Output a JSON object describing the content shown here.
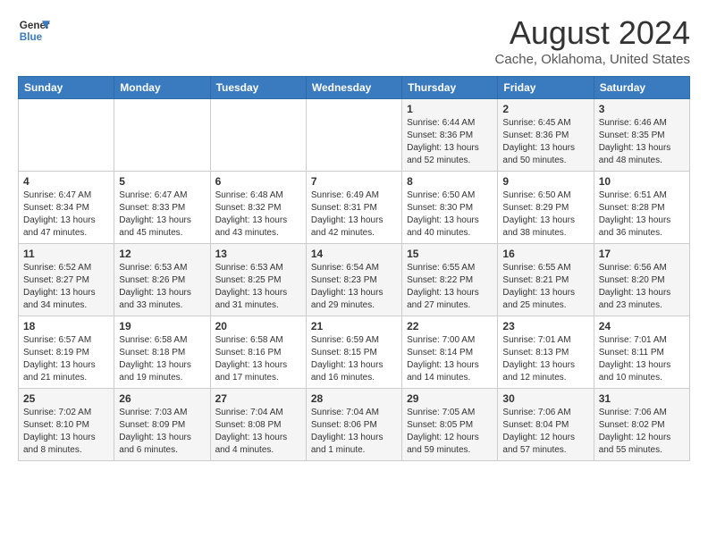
{
  "logo": {
    "line1": "General",
    "line2": "Blue"
  },
  "title": "August 2024",
  "subtitle": "Cache, Oklahoma, United States",
  "weekdays": [
    "Sunday",
    "Monday",
    "Tuesday",
    "Wednesday",
    "Thursday",
    "Friday",
    "Saturday"
  ],
  "weeks": [
    [
      {
        "day": "",
        "sunrise": "",
        "sunset": "",
        "daylight": ""
      },
      {
        "day": "",
        "sunrise": "",
        "sunset": "",
        "daylight": ""
      },
      {
        "day": "",
        "sunrise": "",
        "sunset": "",
        "daylight": ""
      },
      {
        "day": "",
        "sunrise": "",
        "sunset": "",
        "daylight": ""
      },
      {
        "day": "1",
        "sunrise": "Sunrise: 6:44 AM",
        "sunset": "Sunset: 8:36 PM",
        "daylight": "Daylight: 13 hours and 52 minutes."
      },
      {
        "day": "2",
        "sunrise": "Sunrise: 6:45 AM",
        "sunset": "Sunset: 8:36 PM",
        "daylight": "Daylight: 13 hours and 50 minutes."
      },
      {
        "day": "3",
        "sunrise": "Sunrise: 6:46 AM",
        "sunset": "Sunset: 8:35 PM",
        "daylight": "Daylight: 13 hours and 48 minutes."
      }
    ],
    [
      {
        "day": "4",
        "sunrise": "Sunrise: 6:47 AM",
        "sunset": "Sunset: 8:34 PM",
        "daylight": "Daylight: 13 hours and 47 minutes."
      },
      {
        "day": "5",
        "sunrise": "Sunrise: 6:47 AM",
        "sunset": "Sunset: 8:33 PM",
        "daylight": "Daylight: 13 hours and 45 minutes."
      },
      {
        "day": "6",
        "sunrise": "Sunrise: 6:48 AM",
        "sunset": "Sunset: 8:32 PM",
        "daylight": "Daylight: 13 hours and 43 minutes."
      },
      {
        "day": "7",
        "sunrise": "Sunrise: 6:49 AM",
        "sunset": "Sunset: 8:31 PM",
        "daylight": "Daylight: 13 hours and 42 minutes."
      },
      {
        "day": "8",
        "sunrise": "Sunrise: 6:50 AM",
        "sunset": "Sunset: 8:30 PM",
        "daylight": "Daylight: 13 hours and 40 minutes."
      },
      {
        "day": "9",
        "sunrise": "Sunrise: 6:50 AM",
        "sunset": "Sunset: 8:29 PM",
        "daylight": "Daylight: 13 hours and 38 minutes."
      },
      {
        "day": "10",
        "sunrise": "Sunrise: 6:51 AM",
        "sunset": "Sunset: 8:28 PM",
        "daylight": "Daylight: 13 hours and 36 minutes."
      }
    ],
    [
      {
        "day": "11",
        "sunrise": "Sunrise: 6:52 AM",
        "sunset": "Sunset: 8:27 PM",
        "daylight": "Daylight: 13 hours and 34 minutes."
      },
      {
        "day": "12",
        "sunrise": "Sunrise: 6:53 AM",
        "sunset": "Sunset: 8:26 PM",
        "daylight": "Daylight: 13 hours and 33 minutes."
      },
      {
        "day": "13",
        "sunrise": "Sunrise: 6:53 AM",
        "sunset": "Sunset: 8:25 PM",
        "daylight": "Daylight: 13 hours and 31 minutes."
      },
      {
        "day": "14",
        "sunrise": "Sunrise: 6:54 AM",
        "sunset": "Sunset: 8:23 PM",
        "daylight": "Daylight: 13 hours and 29 minutes."
      },
      {
        "day": "15",
        "sunrise": "Sunrise: 6:55 AM",
        "sunset": "Sunset: 8:22 PM",
        "daylight": "Daylight: 13 hours and 27 minutes."
      },
      {
        "day": "16",
        "sunrise": "Sunrise: 6:55 AM",
        "sunset": "Sunset: 8:21 PM",
        "daylight": "Daylight: 13 hours and 25 minutes."
      },
      {
        "day": "17",
        "sunrise": "Sunrise: 6:56 AM",
        "sunset": "Sunset: 8:20 PM",
        "daylight": "Daylight: 13 hours and 23 minutes."
      }
    ],
    [
      {
        "day": "18",
        "sunrise": "Sunrise: 6:57 AM",
        "sunset": "Sunset: 8:19 PM",
        "daylight": "Daylight: 13 hours and 21 minutes."
      },
      {
        "day": "19",
        "sunrise": "Sunrise: 6:58 AM",
        "sunset": "Sunset: 8:18 PM",
        "daylight": "Daylight: 13 hours and 19 minutes."
      },
      {
        "day": "20",
        "sunrise": "Sunrise: 6:58 AM",
        "sunset": "Sunset: 8:16 PM",
        "daylight": "Daylight: 13 hours and 17 minutes."
      },
      {
        "day": "21",
        "sunrise": "Sunrise: 6:59 AM",
        "sunset": "Sunset: 8:15 PM",
        "daylight": "Daylight: 13 hours and 16 minutes."
      },
      {
        "day": "22",
        "sunrise": "Sunrise: 7:00 AM",
        "sunset": "Sunset: 8:14 PM",
        "daylight": "Daylight: 13 hours and 14 minutes."
      },
      {
        "day": "23",
        "sunrise": "Sunrise: 7:01 AM",
        "sunset": "Sunset: 8:13 PM",
        "daylight": "Daylight: 13 hours and 12 minutes."
      },
      {
        "day": "24",
        "sunrise": "Sunrise: 7:01 AM",
        "sunset": "Sunset: 8:11 PM",
        "daylight": "Daylight: 13 hours and 10 minutes."
      }
    ],
    [
      {
        "day": "25",
        "sunrise": "Sunrise: 7:02 AM",
        "sunset": "Sunset: 8:10 PM",
        "daylight": "Daylight: 13 hours and 8 minutes."
      },
      {
        "day": "26",
        "sunrise": "Sunrise: 7:03 AM",
        "sunset": "Sunset: 8:09 PM",
        "daylight": "Daylight: 13 hours and 6 minutes."
      },
      {
        "day": "27",
        "sunrise": "Sunrise: 7:04 AM",
        "sunset": "Sunset: 8:08 PM",
        "daylight": "Daylight: 13 hours and 4 minutes."
      },
      {
        "day": "28",
        "sunrise": "Sunrise: 7:04 AM",
        "sunset": "Sunset: 8:06 PM",
        "daylight": "Daylight: 13 hours and 1 minute."
      },
      {
        "day": "29",
        "sunrise": "Sunrise: 7:05 AM",
        "sunset": "Sunset: 8:05 PM",
        "daylight": "Daylight: 12 hours and 59 minutes."
      },
      {
        "day": "30",
        "sunrise": "Sunrise: 7:06 AM",
        "sunset": "Sunset: 8:04 PM",
        "daylight": "Daylight: 12 hours and 57 minutes."
      },
      {
        "day": "31",
        "sunrise": "Sunrise: 7:06 AM",
        "sunset": "Sunset: 8:02 PM",
        "daylight": "Daylight: 12 hours and 55 minutes."
      }
    ]
  ]
}
